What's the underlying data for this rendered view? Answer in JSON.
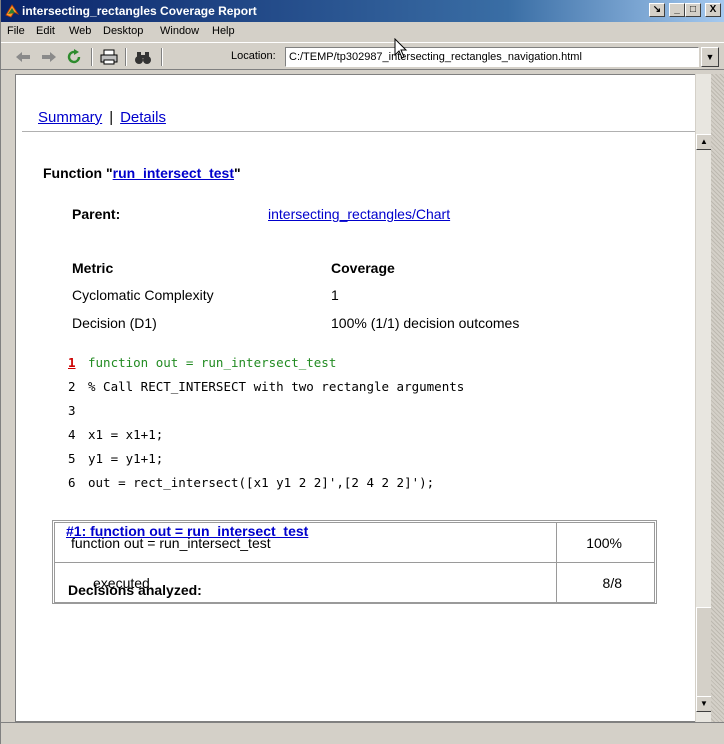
{
  "window": {
    "title": "intersecting_rectangles Coverage Report",
    "controls": {
      "restore_label": "↘",
      "minimize_label": "_",
      "maximize_label": "□",
      "close_label": "X"
    }
  },
  "menu": [
    "File",
    "Edit",
    "Web",
    "Desktop",
    "Window",
    "Help"
  ],
  "toolbar": {
    "location_label": "Location:",
    "location_value": "C:/TEMP/tp302987_intersecting_rectangles_navigation.html"
  },
  "nav": {
    "summary": "Summary",
    "separator": "|",
    "details": "Details"
  },
  "function_heading": {
    "prefix": "Function \"",
    "name": "run_intersect_test",
    "suffix": "\""
  },
  "parent": {
    "label": "Parent:",
    "value": "intersecting_rectangles/Chart"
  },
  "metrics": {
    "header": {
      "metric": "Metric",
      "coverage": "Coverage"
    },
    "rows": [
      {
        "metric": "Cyclomatic Complexity",
        "coverage": "1"
      },
      {
        "metric": "Decision (D1)",
        "coverage": "100% (1/1) decision outcomes"
      }
    ]
  },
  "code_lines": [
    {
      "n": "1",
      "text": "function out = run_intersect_test"
    },
    {
      "n": "2",
      "text": "% Call RECT_INTERSECT with two rectangle arguments"
    },
    {
      "n": "3",
      "text": ""
    },
    {
      "n": "4",
      "text": "x1 = x1+1;"
    },
    {
      "n": "5",
      "text": "y1 = y1+1;"
    },
    {
      "n": "6",
      "text": "out = rect_intersect([x1 y1 2 2]',[2 4 2 2]');"
    }
  ],
  "decision_link": "#1: function out = run_intersect_test",
  "decisions": {
    "title": "Decisions analyzed:",
    "rows": [
      {
        "label": "function out = run_intersect_test",
        "value": "100%"
      },
      {
        "label": "executed",
        "value": "8/8"
      }
    ]
  }
}
